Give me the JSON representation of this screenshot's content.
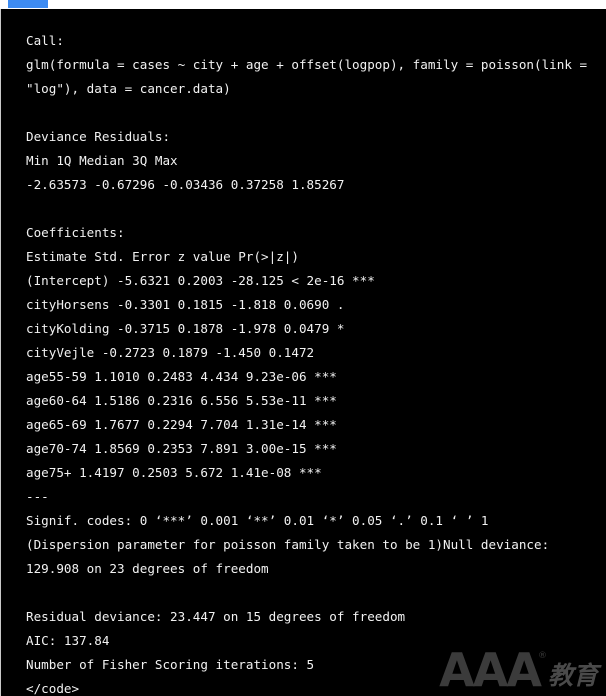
{
  "accent": {
    "bar_color": "#3d8bf2",
    "panel_background": "#000000",
    "text_color": "#f2f2f2"
  },
  "console": {
    "lines": [
      "Call:",
      "glm(formula = cases ~ city + age + offset(logpop), family = poisson(link =",
      "\"log\"), data = cancer.data)",
      "",
      "Deviance Residuals:",
      "Min 1Q Median 3Q Max",
      "-2.63573 -0.67296 -0.03436 0.37258 1.85267",
      "",
      "Coefficients:",
      "Estimate Std. Error z value Pr(>|z|)",
      "(Intercept) -5.6321 0.2003 -28.125 < 2e-16 ***",
      "cityHorsens -0.3301 0.1815 -1.818 0.0690 .",
      "cityKolding -0.3715 0.1878 -1.978 0.0479 *",
      "cityVejle -0.2723 0.1879 -1.450 0.1472",
      "age55-59 1.1010 0.2483 4.434 9.23e-06 ***",
      "age60-64 1.5186 0.2316 6.556 5.53e-11 ***",
      "age65-69 1.7677 0.2294 7.704 1.31e-14 ***",
      "age70-74 1.8569 0.2353 7.891 3.00e-15 ***",
      "age75+ 1.4197 0.2503 5.672 1.41e-08 ***",
      "---",
      "Signif. codes: 0 ‘***’ 0.001 ‘**’ 0.01 ‘*’ 0.05 ‘.’ 0.1 ‘ ’ 1",
      "(Dispersion parameter for poisson family taken to be 1)Null deviance:",
      "129.908 on 23 degrees of freedom",
      "",
      "Residual deviance: 23.447 on 15 degrees of freedom",
      "AIC: 137.84",
      "Number of Fisher Scoring iterations: 5",
      "</code>"
    ],
    "model_summary": {
      "call": "glm(formula = cases ~ city + age + offset(logpop), family = poisson(link = \"log\"), data = cancer.data)",
      "deviance_residuals": {
        "headers": [
          "Min",
          "1Q",
          "Median",
          "3Q",
          "Max"
        ],
        "values": [
          "-2.63573",
          "-0.67296",
          "-0.03436",
          "0.37258",
          "1.85267"
        ]
      },
      "coefficients": {
        "headers": [
          "Estimate",
          "Std. Error",
          "z value",
          "Pr(>|z|)"
        ],
        "rows": [
          {
            "term": "(Intercept)",
            "estimate": "-5.6321",
            "std_error": "0.2003",
            "z_value": "-28.125",
            "p_value": "< 2e-16",
            "signif": "***"
          },
          {
            "term": "cityHorsens",
            "estimate": "-0.3301",
            "std_error": "0.1815",
            "z_value": "-1.818",
            "p_value": "0.0690",
            "signif": "."
          },
          {
            "term": "cityKolding",
            "estimate": "-0.3715",
            "std_error": "0.1878",
            "z_value": "-1.978",
            "p_value": "0.0479",
            "signif": "*"
          },
          {
            "term": "cityVejle",
            "estimate": "-0.2723",
            "std_error": "0.1879",
            "z_value": "-1.450",
            "p_value": "0.1472",
            "signif": ""
          },
          {
            "term": "age55-59",
            "estimate": "1.1010",
            "std_error": "0.2483",
            "z_value": "4.434",
            "p_value": "9.23e-06",
            "signif": "***"
          },
          {
            "term": "age60-64",
            "estimate": "1.5186",
            "std_error": "0.2316",
            "z_value": "6.556",
            "p_value": "5.53e-11",
            "signif": "***"
          },
          {
            "term": "age65-69",
            "estimate": "1.7677",
            "std_error": "0.2294",
            "z_value": "7.704",
            "p_value": "1.31e-14",
            "signif": "***"
          },
          {
            "term": "age70-74",
            "estimate": "1.8569",
            "std_error": "0.2353",
            "z_value": "7.891",
            "p_value": "3.00e-15",
            "signif": "***"
          },
          {
            "term": "age75+",
            "estimate": "1.4197",
            "std_error": "0.2503",
            "z_value": "5.672",
            "p_value": "1.41e-08",
            "signif": "***"
          }
        ]
      },
      "signif_codes": "0 ‘***’ 0.001 ‘**’ 0.01 ‘*’ 0.05 ‘.’ 0.1 ‘ ’ 1",
      "dispersion": "(Dispersion parameter for poisson family taken to be 1)",
      "null_deviance": "129.908 on 23 degrees of freedom",
      "residual_deviance": "23.447 on 15 degrees of freedom",
      "aic": "137.84",
      "fisher_iterations": "5",
      "closing_tag": "</code>"
    }
  },
  "watermark": {
    "mark": "AAA",
    "registered": "®",
    "subtitle": "教育"
  }
}
